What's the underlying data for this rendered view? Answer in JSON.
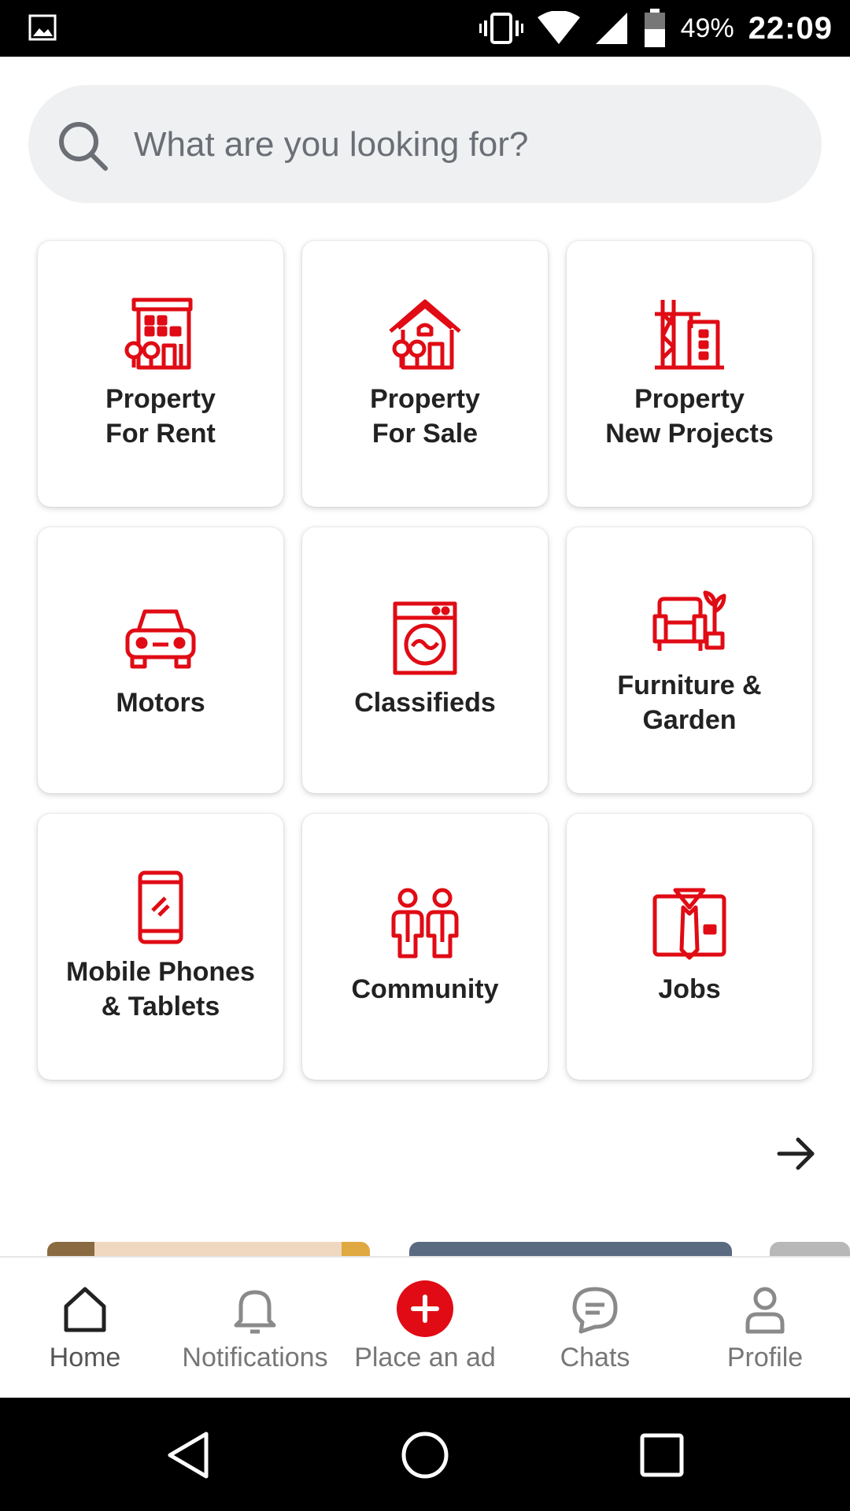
{
  "status_bar": {
    "battery_percent": "49%",
    "clock": "22:09"
  },
  "search": {
    "placeholder": "What are you looking for?"
  },
  "categories": [
    {
      "label": "Property\nFor Rent",
      "icon": "building-icon"
    },
    {
      "label": "Property\nFor Sale",
      "icon": "house-icon"
    },
    {
      "label": "Property\nNew Projects",
      "icon": "crane-building-icon"
    },
    {
      "label": "Motors",
      "icon": "car-icon"
    },
    {
      "label": "Classifieds",
      "icon": "washing-machine-icon"
    },
    {
      "label": "Furniture &\nGarden",
      "icon": "armchair-plant-icon"
    },
    {
      "label": "Mobile Phones\n& Tablets",
      "icon": "mobile-phone-icon"
    },
    {
      "label": "Community",
      "icon": "people-icon"
    },
    {
      "label": "Jobs",
      "icon": "shirt-tie-icon"
    }
  ],
  "bottom_nav": {
    "items": [
      {
        "label": "Home",
        "icon": "home-icon"
      },
      {
        "label": "Notifications",
        "icon": "bell-icon"
      },
      {
        "label": "Place an ad",
        "icon": "plus-circle-icon"
      },
      {
        "label": "Chats",
        "icon": "chat-icon"
      },
      {
        "label": "Profile",
        "icon": "person-icon"
      }
    ]
  },
  "colors": {
    "accent": "#e00b14",
    "active_nav": "#222222",
    "inactive_nav": "#8a8a8a"
  }
}
